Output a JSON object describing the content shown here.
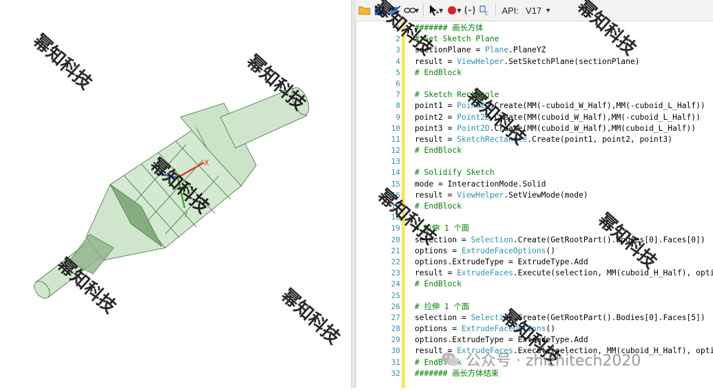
{
  "toolbar": {
    "api_label": "API:",
    "api_version": "V17",
    "icons": [
      "open-folder-icon",
      "save-icon",
      "share-icon",
      "link-icon",
      "select-pointer-icon",
      "record-icon",
      "step-icon",
      "variable-icon"
    ]
  },
  "editor": {
    "lines": [
      {
        "n": "1",
        "text": "####### 画长方体",
        "comment": true
      },
      {
        "n": "2",
        "text": "# Set Sketch Plane",
        "comment": true
      },
      {
        "n": "3",
        "text": "sectionPlane = Plane.PlaneYZ",
        "comment": false
      },
      {
        "n": "4",
        "text": "result = ViewHelper.SetSketchPlane(sectionPlane)",
        "comment": false
      },
      {
        "n": "5",
        "text": "# EndBlock",
        "comment": true
      },
      {
        "n": "6",
        "text": "",
        "comment": false
      },
      {
        "n": "7",
        "text": "# Sketch Rectangle",
        "comment": true
      },
      {
        "n": "8",
        "text": "point1 = Point2D.Create(MM(-cuboid_W_Half),MM(-cuboid_L_Half))",
        "comment": false
      },
      {
        "n": "9",
        "text": "point2 = Point2D.Create(MM(cuboid_W_Half),MM(-cuboid_L_Half))",
        "comment": false
      },
      {
        "n": "10",
        "text": "point3 = Point2D.Create(MM(cuboid_W_Half),MM(cuboid_L_Half))",
        "comment": false
      },
      {
        "n": "11",
        "text": "result = SketchRectangle.Create(point1, point2, point3)",
        "comment": false
      },
      {
        "n": "12",
        "text": "# EndBlock",
        "comment": true
      },
      {
        "n": "13",
        "text": "",
        "comment": false
      },
      {
        "n": "14",
        "text": "# Solidify Sketch",
        "comment": true
      },
      {
        "n": "15",
        "text": "mode = InteractionMode.Solid",
        "comment": false
      },
      {
        "n": "16",
        "text": "result = ViewHelper.SetViewMode(mode)",
        "comment": false
      },
      {
        "n": "17",
        "text": "# EndBlock",
        "comment": true
      },
      {
        "n": "18",
        "text": "",
        "comment": false
      },
      {
        "n": "19",
        "text": "# 拉伸 1 个面",
        "comment": true
      },
      {
        "n": "20",
        "text": "selection = Selection.Create(GetRootPart().Bodies[0].Faces[0])",
        "comment": false
      },
      {
        "n": "21",
        "text": "options = ExtrudeFaceOptions()",
        "comment": false
      },
      {
        "n": "22",
        "text": "options.ExtrudeType = ExtrudeType.Add",
        "comment": false
      },
      {
        "n": "23",
        "text": "result = ExtrudeFaces.Execute(selection, MM(cuboid_H_Half), options)",
        "comment": false
      },
      {
        "n": "24",
        "text": "# EndBlock",
        "comment": true
      },
      {
        "n": "25",
        "text": "",
        "comment": false
      },
      {
        "n": "26",
        "text": "# 拉伸 1 个面",
        "comment": true
      },
      {
        "n": "27",
        "text": "selection = Selection.Create(GetRootPart().Bodies[0].Faces[5])",
        "comment": false
      },
      {
        "n": "28",
        "text": "options = ExtrudeFaceOptions()",
        "comment": false
      },
      {
        "n": "29",
        "text": "options.ExtrudeType = ExtrudeType.Add",
        "comment": false
      },
      {
        "n": "30",
        "text": "result = ExtrudeFaces.Execute(selection, MM(cuboid_H_Half), options)",
        "comment": false
      },
      {
        "n": "31",
        "text": "# EndBlock",
        "comment": true
      },
      {
        "n": "32",
        "text": "####### 画长方体结束",
        "comment": true
      }
    ],
    "class_tokens": [
      "Plane",
      "ViewHelper",
      "Point2D",
      "SketchRectangle",
      "Selection",
      "ExtrudeFaceOptions",
      "ExtrudeFaces"
    ]
  },
  "viewport": {
    "model_fill": "#cfe6cc",
    "model_edge": "#3d6e3d",
    "mesh_fill": "#7fa87a",
    "axis_x_color": "#e03a2f",
    "axis_y_color": "#3aa53a",
    "axis_z_color": "#2f5fe0",
    "axis_x": "X",
    "axis_y": "Y"
  },
  "watermark": {
    "text": "幂知科技"
  },
  "social": {
    "text": "公众号 · zhizhitech2020"
  },
  "colors": {
    "comment": "#008000",
    "line_number": "#2b91af",
    "change_bar": "#ffe455",
    "class_token": "#2b91af"
  }
}
